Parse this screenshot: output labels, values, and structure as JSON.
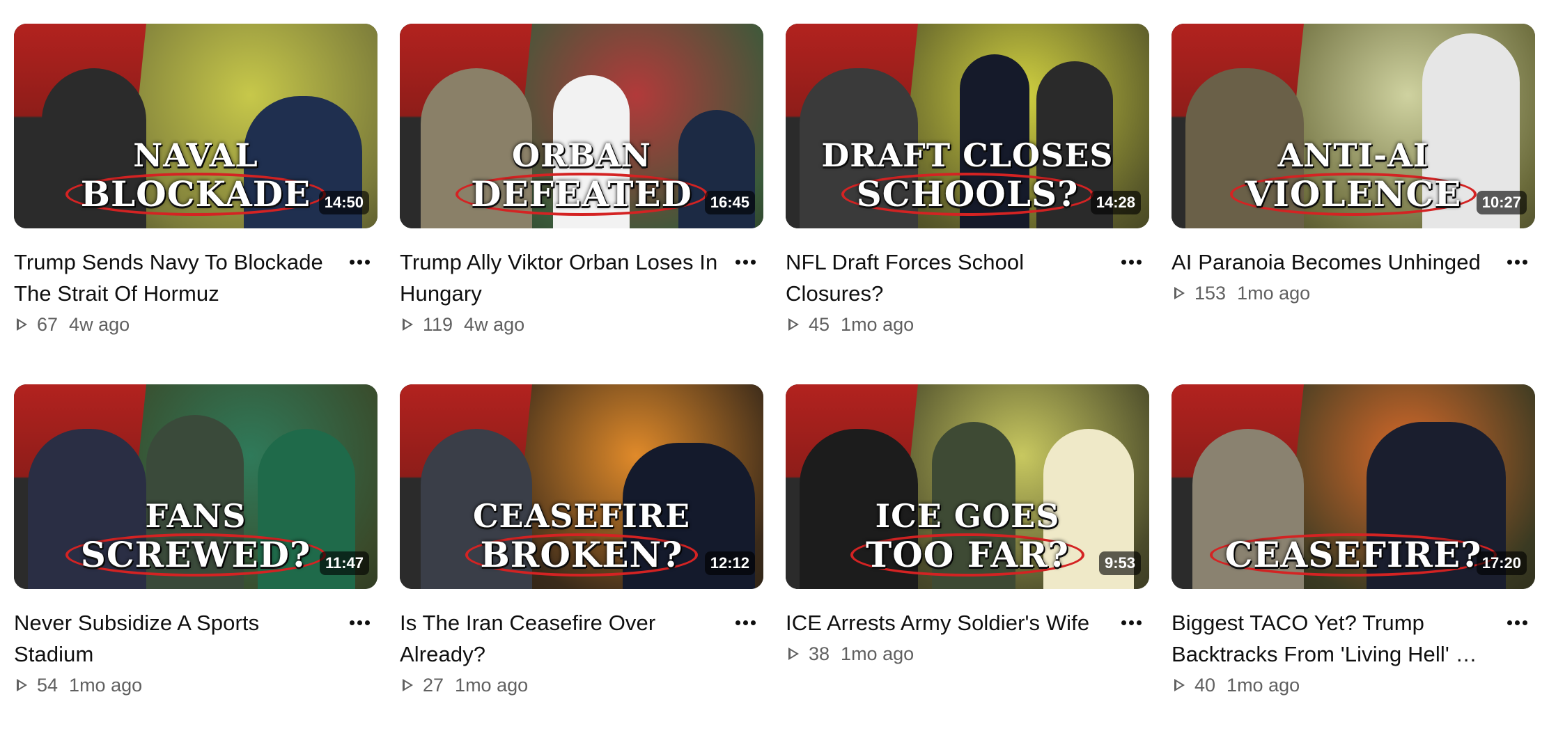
{
  "videos": [
    {
      "title": "Trump Sends Navy To Blockade The Strait Of Hormuz",
      "views": "67",
      "age": "4w ago",
      "duration": "14:50",
      "caption_line1": "NAVAL",
      "caption_line2": "BLOCKADE",
      "thumb_bg": "#7a7a3a",
      "thumb_accent": "#c7c84a"
    },
    {
      "title": "Trump Ally Viktor Orban Loses In Hungary",
      "views": "119",
      "age": "4w ago",
      "duration": "16:45",
      "caption_line1": "ORBAN",
      "caption_line2": "DEFEATED",
      "thumb_bg": "#3a5a3a",
      "thumb_accent": "#b23a3a"
    },
    {
      "title": "NFL Draft Forces School Closures?",
      "views": "45",
      "age": "1mo ago",
      "duration": "14:28",
      "caption_line1": "DRAFT CLOSES",
      "caption_line2": "SCHOOLS?",
      "thumb_bg": "#5a5a2a",
      "thumb_accent": "#d0d040"
    },
    {
      "title": "AI Paranoia Becomes Unhinged",
      "views": "153",
      "age": "1mo ago",
      "duration": "10:27",
      "caption_line1": "ANTI-AI",
      "caption_line2": "VIOLENCE",
      "thumb_bg": "#6a6a3a",
      "thumb_accent": "#cfd2a0"
    },
    {
      "title": "Never Subsidize A Sports Stadium",
      "views": "54",
      "age": "1mo ago",
      "duration": "11:47",
      "caption_line1": "FANS",
      "caption_line2": "SCREWED?",
      "thumb_bg": "#3a4a2a",
      "thumb_accent": "#2f7a5a"
    },
    {
      "title": "Is The Iran Ceasefire Over Already?",
      "views": "27",
      "age": "1mo ago",
      "duration": "12:12",
      "caption_line1": "CEASEFIRE",
      "caption_line2": "BROKEN?",
      "thumb_bg": "#3a2a1a",
      "thumb_accent": "#e08a2a"
    },
    {
      "title": "ICE Arrests Army Soldier's Wife",
      "views": "38",
      "age": "1mo ago",
      "duration": "9:53",
      "caption_line1": "ICE GOES",
      "caption_line2": "TOO FAR?",
      "thumb_bg": "#4a4a2a",
      "thumb_accent": "#c8c860"
    },
    {
      "title": "Biggest TACO Yet? Trump Backtracks From 'Living Hell' …",
      "views": "40",
      "age": "1mo ago",
      "duration": "17:20",
      "caption_line1": "",
      "caption_line2": "CEASEFIRE?",
      "thumb_bg": "#3a3a22",
      "thumb_accent": "#d86a2a"
    }
  ],
  "icons": {
    "more": "more-vert-icon",
    "views": "play-outline-icon"
  },
  "colors": {
    "title": "#0f0f0f",
    "meta": "#606060",
    "brand_red": "#b2221f",
    "duration_bg": "rgba(0,0,0,0.62)"
  }
}
